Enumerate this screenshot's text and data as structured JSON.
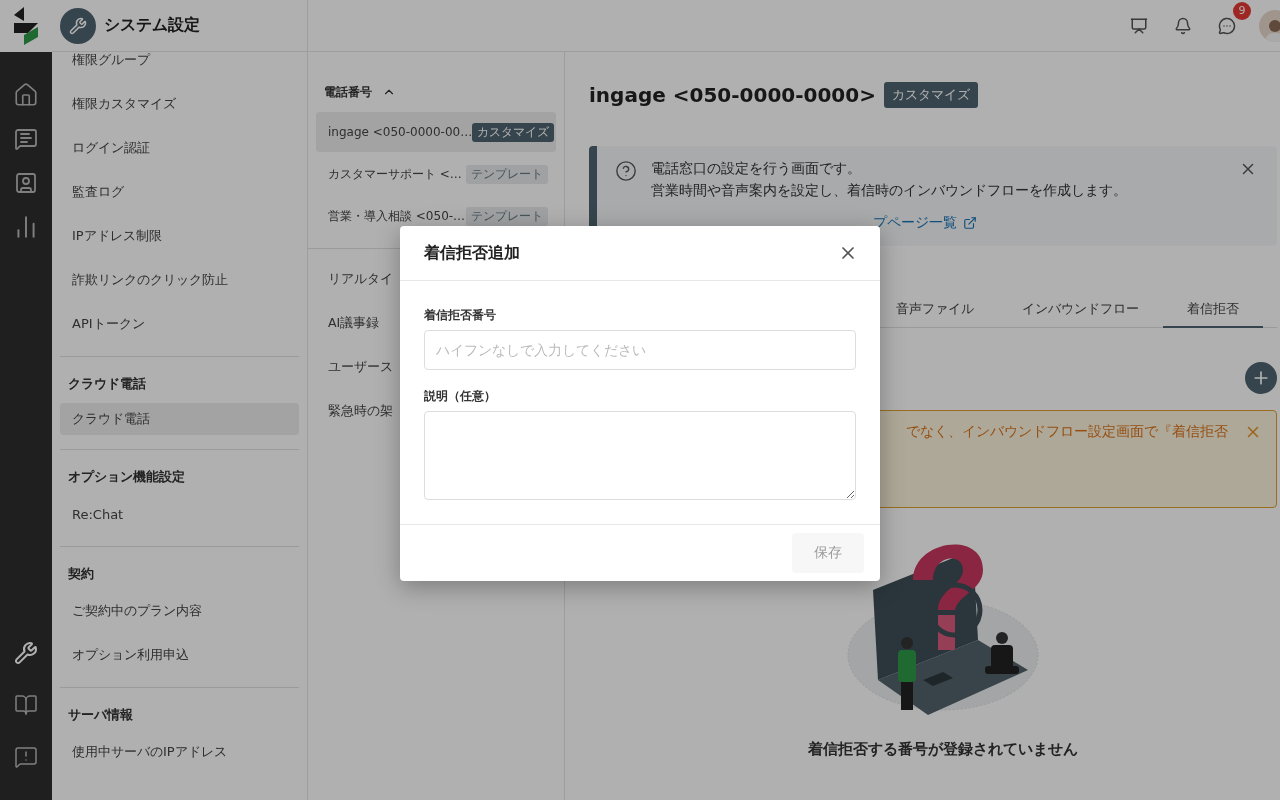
{
  "header": {
    "title": "システム設定",
    "notification_count": "9"
  },
  "sidebar": {
    "sections": [
      {
        "items": [
          {
            "label": "権限グループ",
            "selected": false
          },
          {
            "label": "権限カスタマイズ",
            "selected": false
          },
          {
            "label": "ログイン認証",
            "selected": false
          },
          {
            "label": "監査ログ",
            "selected": false
          },
          {
            "label": "IPアドレス制限",
            "selected": false
          },
          {
            "label": "詐欺リンクのクリック防止",
            "selected": false
          },
          {
            "label": "APIトークン",
            "selected": false
          }
        ]
      },
      {
        "heading": "クラウド電話",
        "items": [
          {
            "label": "クラウド電話",
            "selected": true
          }
        ]
      },
      {
        "heading": "オプション機能設定",
        "items": [
          {
            "label": "Re:Chat",
            "selected": false
          }
        ]
      },
      {
        "heading": "契約",
        "items": [
          {
            "label": "ご契約中のプラン内容",
            "selected": false
          },
          {
            "label": "オプション利用申込",
            "selected": false
          }
        ]
      },
      {
        "heading": "サーバ情報",
        "items": [
          {
            "label": "使用中サーバのIPアドレス",
            "selected": false
          }
        ]
      }
    ]
  },
  "phone_panel": {
    "heading": "電話番号",
    "expanded": true,
    "numbers": [
      {
        "name": "ingage <050-0000-00…",
        "tag": "カスタマイズ",
        "selected": true
      },
      {
        "name": "カスタマーサポート <…",
        "tag": "テンプレート",
        "selected": false
      },
      {
        "name": "営業・導入相談 <050-…",
        "tag": "テンプレート",
        "selected": false
      }
    ],
    "other_items": [
      "リアルタイ",
      "AI議事録",
      "ユーザース",
      "緊急時の架"
    ]
  },
  "main": {
    "title": "ingage <050-0000-0000>",
    "tag": "カスタマイズ",
    "info": {
      "lines": [
        "電話窓口の設定を行う画面です。",
        "営業時間や音声案内を設定し、着信時のインバウンドフローを作成します。"
      ],
      "link": "プページ一覧"
    },
    "tabs": [
      {
        "label": "音声ファイル",
        "selected": false
      },
      {
        "label": "インバウンドフロー",
        "selected": false
      },
      {
        "label": "着信拒否",
        "selected": true
      }
    ],
    "warning": {
      "text": "でなく、インバウンドフロー設定画面で『着信拒否"
    },
    "empty_message": "着信拒否する番号が登録されていません"
  },
  "modal": {
    "title": "着信拒否追加",
    "fields": [
      {
        "kind": "input",
        "label": "着信拒否番号",
        "placeholder": "ハイフンなしで入力してください"
      },
      {
        "kind": "textarea",
        "label": "説明（任意）"
      }
    ],
    "save_button": {
      "label": "保存",
      "disabled": true
    }
  }
}
